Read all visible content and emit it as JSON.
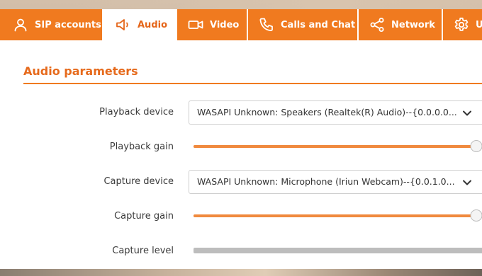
{
  "tabs": [
    {
      "label": "SIP accounts",
      "icon": "user-icon",
      "active": false
    },
    {
      "label": "Audio",
      "icon": "speaker-icon",
      "active": true
    },
    {
      "label": "Video",
      "icon": "video-camera-icon",
      "active": false
    },
    {
      "label": "Calls and Chat",
      "icon": "phone-icon",
      "active": false
    },
    {
      "label": "Network",
      "icon": "share-network-icon",
      "active": false
    },
    {
      "label": "U",
      "icon": "gear-icon",
      "active": false
    }
  ],
  "section": {
    "title": "Audio parameters"
  },
  "fields": {
    "playback_device": {
      "label": "Playback device",
      "value": "WASAPI Unknown: Speakers (Realtek(R) Audio)--{0.0.0.0..."
    },
    "playback_gain": {
      "label": "Playback gain",
      "level": 0.95
    },
    "capture_device": {
      "label": "Capture device",
      "value": "WASAPI Unknown: Microphone (Iriun Webcam)--{0.0.1.0..."
    },
    "capture_gain": {
      "label": "Capture gain",
      "level": 0.95
    },
    "capture_level": {
      "label": "Capture level",
      "level": 0
    }
  },
  "colors": {
    "accent": "#f07a1f",
    "title": "#e66a1c",
    "text": "#3a3a3a"
  }
}
